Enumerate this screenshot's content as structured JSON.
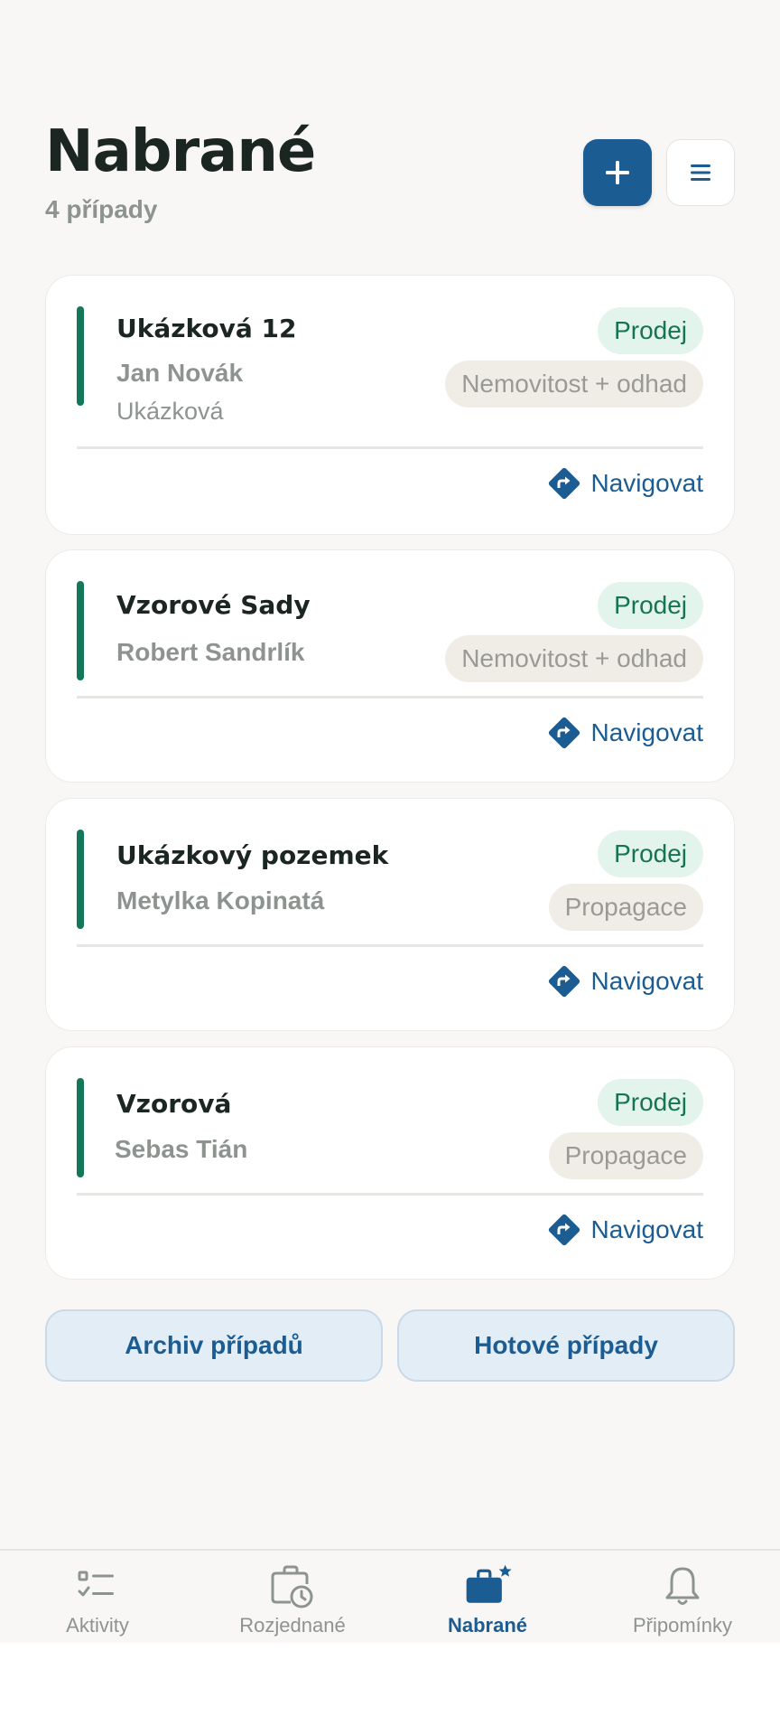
{
  "header": {
    "title": "Nabrané",
    "subtitle": "4 případy",
    "add_icon": "plus-icon",
    "menu_icon": "hamburger-menu-icon"
  },
  "cards": [
    {
      "title": "Ukázková 12",
      "person": "Jan Novák",
      "place": "Ukázková",
      "badge_sale": "Prodej",
      "badge_type": "Nemovitost + odhad",
      "navigate_label": "Navigovat"
    },
    {
      "title": "Vzorové Sady",
      "person": "Robert Sandrlík",
      "badge_sale": "Prodej",
      "badge_type": "Nemovitost + odhad",
      "navigate_label": "Navigovat"
    },
    {
      "title": "Ukázkový pozemek",
      "person": "Metylka Kopinatá",
      "badge_sale": "Prodej",
      "badge_type": "Propagace",
      "navigate_label": "Navigovat"
    },
    {
      "title": "Vzorová",
      "person": "Sebas Tián",
      "badge_sale": "Prodej",
      "badge_type": "Propagace",
      "navigate_label": "Navigovat"
    }
  ],
  "footer": {
    "archive_label": "Archiv případů",
    "done_label": "Hotové případy"
  },
  "bottom_nav": {
    "items": [
      {
        "label": "Aktivity",
        "icon": "checklist-icon"
      },
      {
        "label": "Rozjednané",
        "icon": "briefcase-clock-icon"
      },
      {
        "label": "Nabrané",
        "icon": "briefcase-star-icon",
        "active": true
      },
      {
        "label": "Připomínky",
        "icon": "bell-icon"
      }
    ]
  },
  "colors": {
    "primary": "#1b5c93",
    "accent_green": "#13775a",
    "background": "#f9f7f5",
    "muted_text": "#8d9490"
  }
}
